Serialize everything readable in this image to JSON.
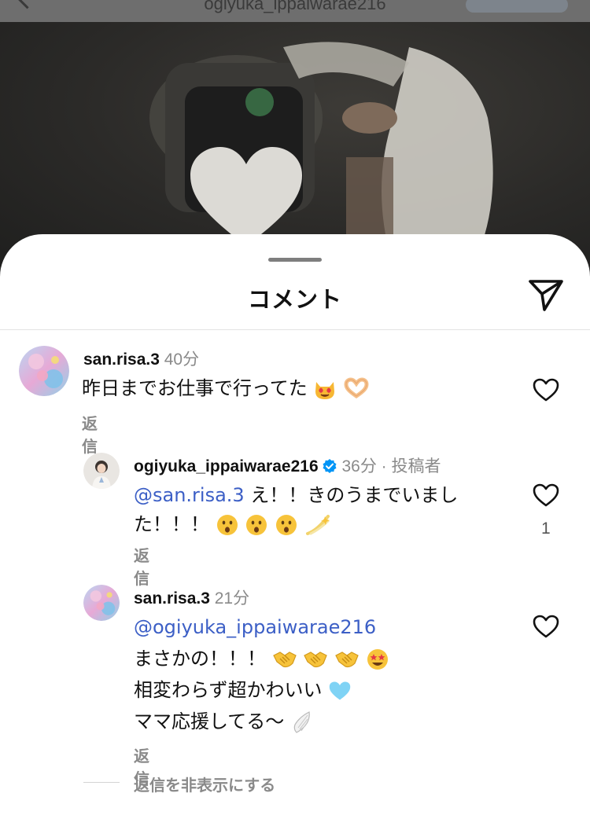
{
  "header": {
    "username": "ogiyuka_ippaiwarae216"
  },
  "sheet": {
    "title": "コメント"
  },
  "comments": [
    {
      "username": "san.risa.3",
      "time": "40分",
      "text": "昨日までお仕事で行ってた",
      "emojis": [
        "heart-eyes-cat",
        "heart-hands"
      ],
      "reply_label": "返信"
    },
    {
      "username": "ogiyuka_ippaiwarae216",
      "time": "36分",
      "author_badge": "投稿者",
      "mention": "@san.risa.3",
      "line1": " え！！きのうまでいまし",
      "line2": "た！！！",
      "emojis": [
        "surprised",
        "surprised",
        "surprised",
        "dizzy"
      ],
      "reply_label": "返信",
      "like_count": "1"
    },
    {
      "username": "san.risa.3",
      "time": "21分",
      "mention": "@ogiyuka_ippaiwarae216",
      "line1": "まさかの！！！",
      "line1_emojis": [
        "handshake",
        "handshake",
        "handshake",
        "star-struck"
      ],
      "line2": "相変わらず超かわいい",
      "line2_emojis": [
        "light-blue-heart"
      ],
      "line3": "ママ応援してる〜",
      "line3_emojis": [
        "wing"
      ],
      "reply_label": "返信"
    }
  ],
  "hide_replies_label": "返信を非表示にする",
  "colors": {
    "mention": "#3c5fc6",
    "verified": "#0095f6",
    "meta": "#8a8a8a"
  }
}
